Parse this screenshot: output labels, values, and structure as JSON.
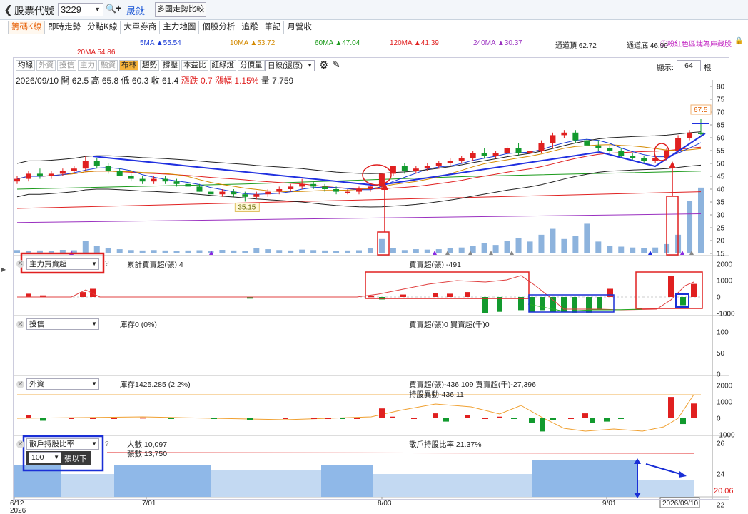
{
  "topbar": {
    "back_icon": "chevron-left-icon",
    "label": "股票代號",
    "stock_code": "3229",
    "stock_name": "晟鈦",
    "compare": "多國走勢比較"
  },
  "tabs": [
    "籌碼K線",
    "即時走勢",
    "分點K線",
    "大單券商",
    "主力地圖",
    "個股分析",
    "追蹤",
    "筆記",
    "月營收"
  ],
  "ma_legend": [
    {
      "text": "5MA ▲55.54",
      "color": "#1a3bd6"
    },
    {
      "text": "10MA ▲53.72",
      "color": "#d48a00"
    },
    {
      "text": "60MA ▲47.04",
      "color": "#1a9a1a"
    },
    {
      "text": "120MA ▲41.39",
      "color": "#e02020"
    },
    {
      "text": "240MA ▲30.37",
      "color": "#9a30c0"
    },
    {
      "text": "通道頂 62.72",
      "color": "#222222"
    },
    {
      "text": "通道底 46.99",
      "color": "#222222"
    },
    {
      "text": "20MA 54.86",
      "color": "#e02020"
    }
  ],
  "hint": "ⓘ粉紅色區塊為庫藏股",
  "toolbar": {
    "buttons": [
      "均線",
      "外資",
      "投信",
      "主力",
      "融資",
      "布林",
      "趨勢",
      "撐壓",
      "本益比",
      "紅綠燈",
      "分價量"
    ],
    "period": "日線(還原)",
    "show_label": "顯示:",
    "show_value": "64",
    "root": "根"
  },
  "ohlc": {
    "date": "2026/09/10",
    "open_l": "開",
    "open": "62.5",
    "high_l": "高",
    "high": "65.8",
    "low_l": "低",
    "low": "60.3",
    "close_l": "收",
    "close": "61.4",
    "chg_l": "漲跌",
    "chg": "0.7",
    "pct_l": "漲幅",
    "pct": "1.15%",
    "vol_l": "量",
    "vol": "7,759"
  },
  "panels": {
    "main_force": {
      "select": "主力買賣超",
      "legend1": "累計買賣超(張) 4",
      "legend2": "買賣超(張) -491",
      "yticks": [
        "2000",
        "1000",
        "0",
        "-1000"
      ]
    },
    "trust": {
      "select": "投信",
      "legend1": "庫存0 (0%)",
      "legend2": "買賣超(張)0 買賣超(千)0",
      "yticks": [
        "100",
        "50",
        "0"
      ]
    },
    "foreign": {
      "select": "外資",
      "legend1": "庫存1425.285 (2.2%)",
      "legend2": "買賣超(張)-436.109 買賣超(千)-27,396",
      "legend3": "持股異動-436.11",
      "yticks": [
        "2000",
        "1000",
        "0",
        "-1000"
      ]
    },
    "holders": {
      "select": "散戶持股比率",
      "sub_select": "100",
      "sub_label": "張以下",
      "legend1": "人數 10,097",
      "legend2": "張數 13,750",
      "legend3": "散戶持股比率 21.37%",
      "yticks": [
        "26",
        "24",
        "22"
      ],
      "last": "20.06"
    }
  },
  "main_yticks": [
    "80",
    "75",
    "70",
    "65",
    "60",
    "55",
    "50",
    "45",
    "40",
    "35",
    "30",
    "25",
    "20",
    "15"
  ],
  "price_labels": {
    "high": "67.5",
    "low": "35.15"
  },
  "xaxis": {
    "ticks": [
      "6/12",
      "7/01",
      "8/03",
      "9/01"
    ],
    "year": "2026",
    "current": "2026/09/10"
  },
  "chart_data": {
    "type": "candlestick",
    "candles": [
      [
        43,
        45,
        42,
        44
      ],
      [
        44,
        47,
        43,
        46
      ],
      [
        46,
        48,
        44,
        45
      ],
      [
        45,
        47,
        44,
        46
      ],
      [
        46,
        48,
        45,
        47
      ],
      [
        47,
        49,
        46,
        48
      ],
      [
        48,
        53,
        47,
        51
      ],
      [
        51,
        52,
        48,
        49
      ],
      [
        49,
        50,
        46,
        47
      ],
      [
        47,
        48,
        45,
        45
      ],
      [
        45,
        46,
        43,
        44
      ],
      [
        44,
        45,
        42,
        43
      ],
      [
        43,
        45,
        42,
        44
      ],
      [
        44,
        45,
        42,
        43
      ],
      [
        43,
        44,
        41,
        42
      ],
      [
        42,
        43,
        40,
        41
      ],
      [
        41,
        42,
        39,
        39
      ],
      [
        39,
        40,
        38,
        38
      ],
      [
        38,
        40,
        37,
        39
      ],
      [
        39,
        40,
        37,
        38
      ],
      [
        38,
        39,
        35.15,
        37
      ],
      [
        37,
        39,
        36,
        38
      ],
      [
        38,
        40,
        37,
        39
      ],
      [
        39,
        41,
        38,
        40
      ],
      [
        40,
        42,
        39,
        41
      ],
      [
        41,
        44,
        40,
        42
      ],
      [
        42,
        43,
        40,
        41
      ],
      [
        41,
        42,
        39,
        40
      ],
      [
        40,
        41,
        38,
        39
      ],
      [
        39,
        40,
        38,
        39
      ],
      [
        39,
        41,
        38,
        40
      ],
      [
        40,
        42,
        39,
        41
      ],
      [
        41,
        46,
        40,
        46
      ],
      [
        46,
        49,
        45,
        49
      ],
      [
        49,
        50,
        46,
        47
      ],
      [
        47,
        49,
        46,
        48
      ],
      [
        48,
        50,
        47,
        49
      ],
      [
        49,
        51,
        48,
        50
      ],
      [
        50,
        52,
        49,
        51
      ],
      [
        51,
        53,
        50,
        52
      ],
      [
        52,
        55,
        51,
        54
      ],
      [
        54,
        56,
        52,
        53
      ],
      [
        53,
        55,
        52,
        54
      ],
      [
        54,
        57,
        53,
        56
      ],
      [
        56,
        58,
        53,
        54
      ],
      [
        54,
        56,
        52,
        55
      ],
      [
        55,
        59,
        54,
        58
      ],
      [
        58,
        62,
        56,
        61
      ],
      [
        61,
        63,
        60,
        62
      ],
      [
        62,
        63,
        58,
        59
      ],
      [
        59,
        60,
        57,
        57
      ],
      [
        57,
        59,
        55,
        56
      ],
      [
        56,
        57,
        54,
        55
      ],
      [
        55,
        56,
        52,
        53
      ],
      [
        53,
        54,
        51,
        52
      ],
      [
        52,
        53,
        50,
        51
      ],
      [
        51,
        53,
        50,
        52
      ],
      [
        52,
        56,
        51,
        55
      ],
      [
        55,
        61,
        54,
        60
      ],
      [
        60,
        63,
        59,
        62
      ],
      [
        62,
        67.5,
        61,
        61.4
      ]
    ],
    "volume": [
      400,
      300,
      350,
      300,
      420,
      380,
      1500,
      900,
      600,
      500,
      400,
      350,
      400,
      350,
      300,
      350,
      380,
      300,
      420,
      350,
      300,
      600,
      500,
      400,
      350,
      450,
      400,
      350,
      300,
      350,
      380,
      600,
      1700,
      600,
      400,
      500,
      450,
      500,
      650,
      700,
      900,
      1200,
      1000,
      1500,
      1800,
      1400,
      2200,
      2900,
      1700,
      2100,
      3500,
      1400,
      900,
      800,
      700,
      650,
      700,
      1100,
      2200,
      6200,
      7759
    ],
    "main_force": [
      200,
      100,
      300,
      500,
      -100,
      50,
      -150,
      150,
      250,
      200,
      300,
      -1000,
      -900,
      -800,
      -900,
      -800,
      -900,
      -900,
      -950,
      -950,
      -800,
      500,
      1300,
      -500,
      800
    ]
  }
}
